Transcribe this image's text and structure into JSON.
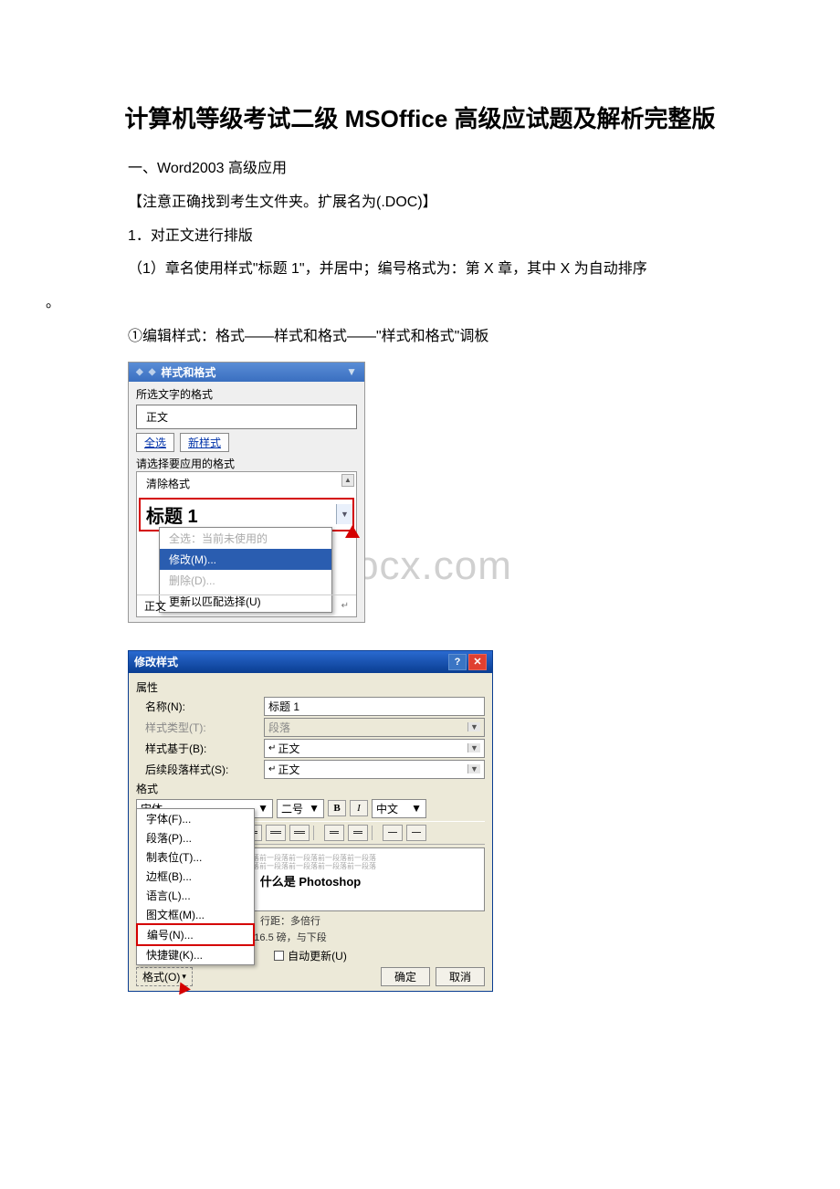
{
  "doc": {
    "title": "计算机等级考试二级 MSOffice 高级应试题及解析完整版",
    "p1": "一、Word2003 高级应用",
    "p2": "【注意正确找到考生文件夹。扩展名为(.DOC)】",
    "p3": "1．对正文进行排版",
    "p4": "（1）章名使用样式\"标题 1\"，并居中；编号格式为：第 X 章，其中 X 为自动排序",
    "p4b": "。",
    "p5": "①编辑样式：格式——样式和格式——\"样式和格式\"调板"
  },
  "watermark": "www.bdocx.com",
  "panel1": {
    "header": "样式和格式",
    "current_label": "所选文字的格式",
    "current_value": "正文",
    "select_all": "全选",
    "new_style": "新样式",
    "choose_label": "请选择要应用的格式",
    "clear_fmt": "清除格式",
    "heading1": "标题 1",
    "cm_selectall": "全选：当前未使用的",
    "cm_modify": "修改(M)...",
    "cm_delete": "删除(D)...",
    "cm_update": "更新以匹配选择(U)",
    "body_text": "正文"
  },
  "panel2": {
    "title": "修改样式",
    "section_props": "属性",
    "name_label": "名称(N):",
    "name_value": "标题 1",
    "type_label": "样式类型(T):",
    "type_value": "段落",
    "based_label": "样式基于(B):",
    "based_value": "正文",
    "follow_label": "后续段落样式(S):",
    "follow_value": "正文",
    "section_format": "格式",
    "font_value": "宋体",
    "size_value": "二号",
    "lang_value": "中文",
    "preview_heading": "什么是 Photoshop",
    "desc1": "粗，字距调整二号，居中，行距：多倍行",
    "desc2": "距，段前：17 磅，段后：16.5 磅，与下段",
    "fm_font": "字体(F)...",
    "fm_para": "段落(P)...",
    "fm_tab": "制表位(T)...",
    "fm_border": "边框(B)...",
    "fm_lang": "语言(L)...",
    "fm_frame": "图文框(M)...",
    "fm_number": "编号(N)...",
    "fm_shortcut": "快捷键(K)...",
    "auto_update": "自动更新(U)",
    "format_btn": "格式(O)",
    "ok": "确定",
    "cancel": "取消"
  }
}
